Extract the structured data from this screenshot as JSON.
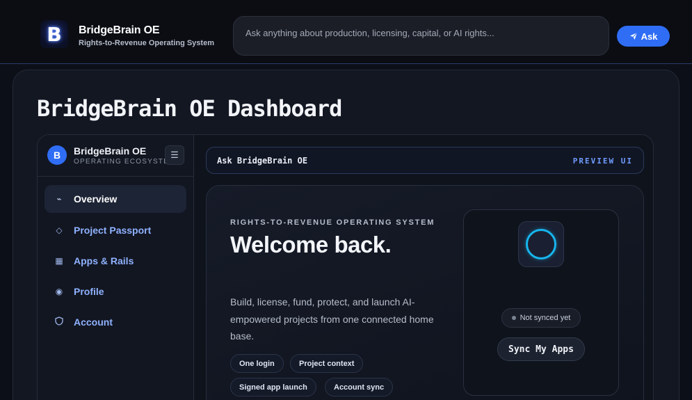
{
  "header": {
    "logo_letter": "B",
    "brand_name": "BridgeBrain OE",
    "brand_tagline": "Rights-to-Revenue Operating System",
    "search_placeholder": "Ask anything about production, licensing, capital, or AI rights...",
    "ask_label": "Ask",
    "ask_icon": "paper-plane-icon",
    "accent_color": "#2f6df5"
  },
  "page": {
    "title": "BridgeBrain OE Dashboard"
  },
  "sidebar": {
    "avatar_letter": "B",
    "title": "BridgeBrain OE",
    "subtitle": "OPERATING ECOSYSTEM",
    "menu_icon": "hamburger-icon",
    "items": [
      {
        "label": "Overview",
        "icon": "pulse-icon",
        "active": true
      },
      {
        "label": "Project Passport",
        "icon": "diamond-icon",
        "active": false
      },
      {
        "label": "Apps & Rails",
        "icon": "grid-icon",
        "active": false
      },
      {
        "label": "Profile",
        "icon": "target-icon",
        "active": false
      },
      {
        "label": "Account",
        "icon": "shield-icon",
        "active": false
      }
    ]
  },
  "ask_bar": {
    "label": "Ask BridgeBrain OE",
    "tag": "PREVIEW UI"
  },
  "hero": {
    "eyebrow": "RIGHTS-TO-REVENUE OPERATING SYSTEM",
    "title": "Welcome back.",
    "description": "Build, license, fund, protect, and launch AI-empowered projects from one connected home base.",
    "chips": [
      "One login",
      "Project context",
      "Signed app launch",
      "Account sync"
    ]
  },
  "sync_card": {
    "status": "Not synced yet",
    "button_label": "Sync My Apps",
    "orb_color": "#17b5ee"
  }
}
